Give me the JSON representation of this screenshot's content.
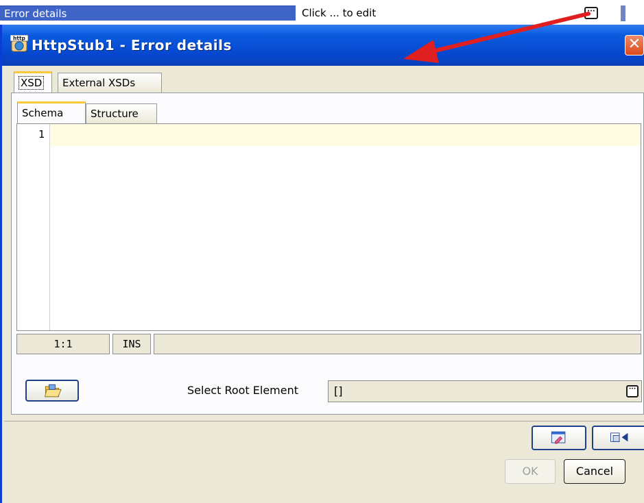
{
  "property_row": {
    "name": "Error details",
    "value": "Click ... to edit",
    "edit_button": "···"
  },
  "dialog": {
    "icon_text": "http",
    "title": "HttpStub1 - Error details",
    "close_label": "✕",
    "tabs": [
      {
        "label": "XSD",
        "active": true
      },
      {
        "label": "External XSDs",
        "active": false
      }
    ],
    "subtabs": [
      {
        "label": "Schema",
        "active": true
      },
      {
        "label": "Structure",
        "active": false
      }
    ],
    "editor": {
      "line_number": "1",
      "content": ""
    },
    "status": {
      "position": "1:1",
      "mode": "INS"
    },
    "root_element": {
      "label": "Select Root Element",
      "value": "[]",
      "button": "···"
    },
    "ok_label": "OK",
    "cancel_label": "Cancel"
  },
  "colors": {
    "titlebar": "#0a5bdf",
    "selected_row": "#3e64c8",
    "dialog_bg": "#ece9d8",
    "active_tab_accent": "#ffc83c",
    "line_highlight": "#fefce2",
    "arrow": "#e02020"
  },
  "icons": {
    "folder_open": "open-folder-icon",
    "toolbar_1": "window-edit-icon",
    "toolbar_2": "panel-arrow-icon"
  }
}
